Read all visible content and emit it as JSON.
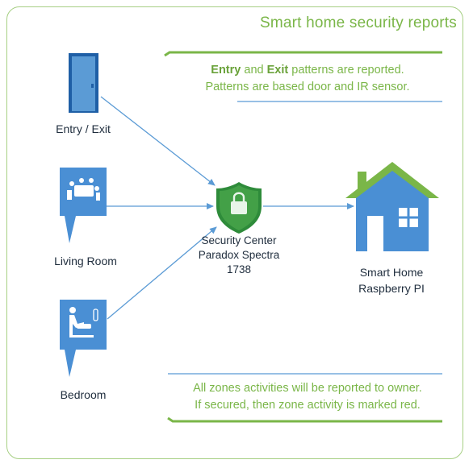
{
  "title": "Smart home security reports",
  "top_note": {
    "line1_bold1": "Entry",
    "line1_mid": "and",
    "line1_bold2": "Exit",
    "line1_end": "patterns are reported.",
    "line2": "Patterns are based door and IR sensor."
  },
  "nodes": {
    "entry": "Entry / Exit",
    "living": "Living Room",
    "bedroom": "Bedroom",
    "security_line1": "Security Center",
    "security_line2": "Paradox Spectra",
    "security_line3": "1738",
    "home_line1": "Smart Home",
    "home_line2": "Raspberry PI"
  },
  "bottom_note": {
    "line1": "All zones activities will be reported to owner.",
    "line2": "If secured, then zone activity is marked red."
  },
  "colors": {
    "accent_green": "#7ab648",
    "icon_blue": "#4a8fd4",
    "arrow_blue": "#5b9bd5"
  }
}
